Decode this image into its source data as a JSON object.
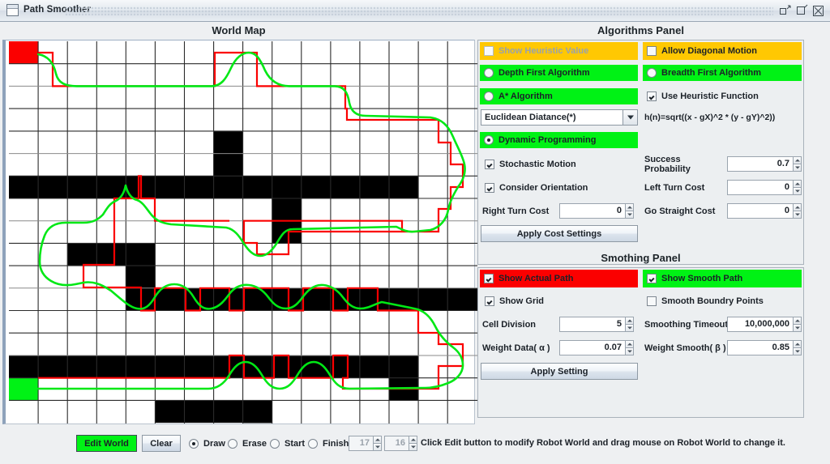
{
  "window": {
    "title": "Path Smoother",
    "icon": "window-icon",
    "buttons": [
      {
        "name": "minimize-button",
        "label": "Minimize"
      },
      {
        "name": "maximize-button",
        "label": "Maximize"
      },
      {
        "name": "close-button",
        "label": "Close"
      }
    ]
  },
  "map": {
    "title": "World Map",
    "cols": 16,
    "rows": 17,
    "start_color": "#fb0000",
    "goal_color": "#00f215",
    "obstacle_color": "#000000",
    "actual_path_color": "#fb0000",
    "smooth_path_color": "#00e815"
  },
  "algorithms": {
    "title": "Algorithms Panel",
    "show_heuristic_value": {
      "label": "Show Heuristic Value",
      "checked": false,
      "enabled": false,
      "bg": "#ffc802"
    },
    "allow_diagonal_motion": {
      "label": "Allow Diagonal Motion",
      "checked": false,
      "enabled": true,
      "bg": "#ffc802"
    },
    "depth_first": {
      "label": "Depth First Algorithm",
      "selected": false,
      "bg": "#00f215"
    },
    "breadth_first": {
      "label": "Breadth First Algorithm",
      "selected": false,
      "bg": "#00f215"
    },
    "a_star": {
      "label": "A* Algorithm",
      "selected": false,
      "bg": "#00f215"
    },
    "use_heuristic_function": {
      "label": "Use Heuristic Function",
      "checked": true
    },
    "heuristic_select": {
      "value": "Euclidean Diatance(*)",
      "options": [
        "Euclidean Diatance(*)"
      ]
    },
    "heuristic_formula": "h(n)=sqrt((x - gX)^2 * (y - gY)^2))",
    "dynamic_programming": {
      "label": "Dynamic Programming",
      "selected": true,
      "bg": "#00f215"
    },
    "stochastic_motion": {
      "label": "Stochastic Motion",
      "checked": true
    },
    "consider_orientation": {
      "label": "Consider Orientation",
      "checked": true
    },
    "success_probability": {
      "label": "Success Probability",
      "value": "0.7"
    },
    "left_turn_cost": {
      "label": "Left Turn Cost",
      "value": "0"
    },
    "right_turn_cost": {
      "label": "Right Turn Cost",
      "value": "0"
    },
    "go_straight_cost": {
      "label": "Go Straight Cost",
      "value": "0"
    },
    "apply_cost_settings": "Apply Cost Settings"
  },
  "smoothing": {
    "title": "Smothing Panel",
    "show_actual_path": {
      "label": "Show Actual Path",
      "checked": true,
      "bg": "#fb0000"
    },
    "show_smooth_path": {
      "label": "Show Smooth Path",
      "checked": true,
      "bg": "#00f215"
    },
    "show_grid": {
      "label": "Show Grid",
      "checked": true
    },
    "smooth_boundry_points": {
      "label": "Smooth Boundry Points",
      "checked": false
    },
    "cell_division": {
      "label": "Cell Division",
      "value": "5"
    },
    "smoothing_timeout": {
      "label": "Smoothing Timeout",
      "value": "10,000,000"
    },
    "weight_data": {
      "label": "Weight Data( α )",
      "value": "0.07"
    },
    "weight_smooth": {
      "label": "Weight Smooth( β )",
      "value": "0.85"
    },
    "apply_setting": "Apply Setting"
  },
  "toolbar": {
    "edit_world": "Edit World",
    "clear": "Clear",
    "draw": {
      "label": "Draw",
      "selected": true
    },
    "erase": {
      "label": "Erase",
      "selected": false
    },
    "start": {
      "label": "Start",
      "selected": false
    },
    "finish": {
      "label": "Finish",
      "selected": false
    },
    "width_spinner": {
      "value": "17",
      "enabled": false
    },
    "height_spinner": {
      "value": "16",
      "enabled": false
    },
    "hint": "Click Edit button to modify Robot World and drag mouse on Robot World to change it."
  }
}
